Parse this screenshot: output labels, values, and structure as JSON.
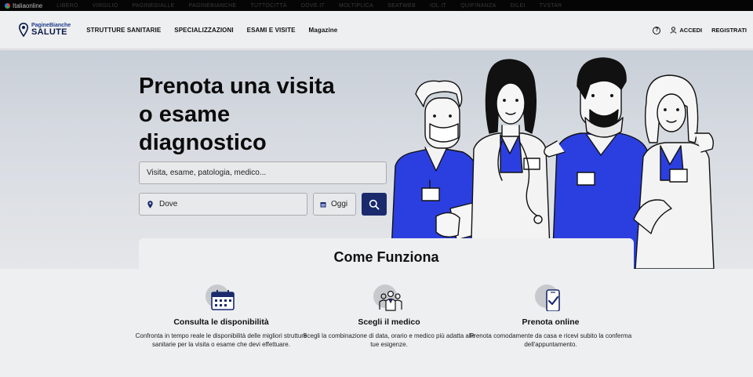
{
  "topbar": {
    "brand": "Italiaonline",
    "links": [
      "LIBERO",
      "VIRGILIO",
      "PAGINEGIALLE",
      "PAGINEBIANCHE",
      "TUTTOCITTÀ",
      "DOVE.IT",
      "MOLTIPLICA",
      "SEATWEB",
      "IOL.IT",
      "QUIFINANZA",
      "DILEI",
      "TVSTAR"
    ]
  },
  "header": {
    "logo_top": "PagineBianche",
    "logo_bottom": "SALUTE",
    "nav": [
      "STRUTTURE SANITARIE",
      "SPECIALIZZAZIONI",
      "ESAMI E VISITE",
      "Magazine"
    ],
    "help": "?",
    "login": "ACCEDI",
    "register": "REGISTRATI"
  },
  "hero": {
    "title": "Prenota una visita o esame diagnostico",
    "search_placeholder": "Visita, esame, patologia, medico...",
    "where_placeholder": "Dove",
    "when_value": "Oggi"
  },
  "how": {
    "title": "Come Funziona",
    "steps": [
      {
        "icon": "calendar-icon",
        "title": "Consulta le disponibilità",
        "text": "Confronta in tempo reale le disponibilità delle migliori strutture sanitarie per la visita o esame che devi effettuare."
      },
      {
        "icon": "doctors-icon",
        "title": "Scegli il medico",
        "text": "Scegli la combinazione di data, orario e medico più adatta alle tue esigenze."
      },
      {
        "icon": "phone-check-icon",
        "title": "Prenota online",
        "text": "Prenota comodamente da casa e ricevi subito la conferma dell'appuntamento."
      }
    ]
  },
  "colors": {
    "accent_blue": "#1a2a6c",
    "scrub_blue": "#2b3fe0"
  }
}
